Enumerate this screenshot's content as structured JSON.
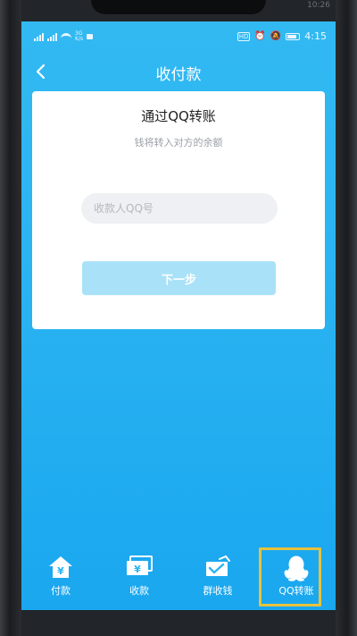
{
  "status_bar": {
    "signal_tiny_top": "3G",
    "signal_tiny_bottom": "K/s",
    "time": "4:15"
  },
  "frame_time": "10:26",
  "nav": {
    "back_icon": "chevron-left-icon",
    "title": "收付款"
  },
  "card": {
    "title": "通过QQ转账",
    "subtitle": "钱将转入对方的余额",
    "input_placeholder": "收款人QQ号",
    "input_value": "",
    "next_label": "下一步"
  },
  "tabs": [
    {
      "label": "付款",
      "icon": "payment-house-icon",
      "active": false
    },
    {
      "label": "收款",
      "icon": "receive-money-icon",
      "active": false
    },
    {
      "label": "群收钱",
      "icon": "group-collect-icon",
      "active": false
    },
    {
      "label": "QQ转账",
      "icon": "qq-penguin-icon",
      "active": true
    }
  ],
  "colors": {
    "screen_blue": "#2bb4f2",
    "button_disabled": "#a9e2f8",
    "active_highlight": "#e8c23c"
  }
}
